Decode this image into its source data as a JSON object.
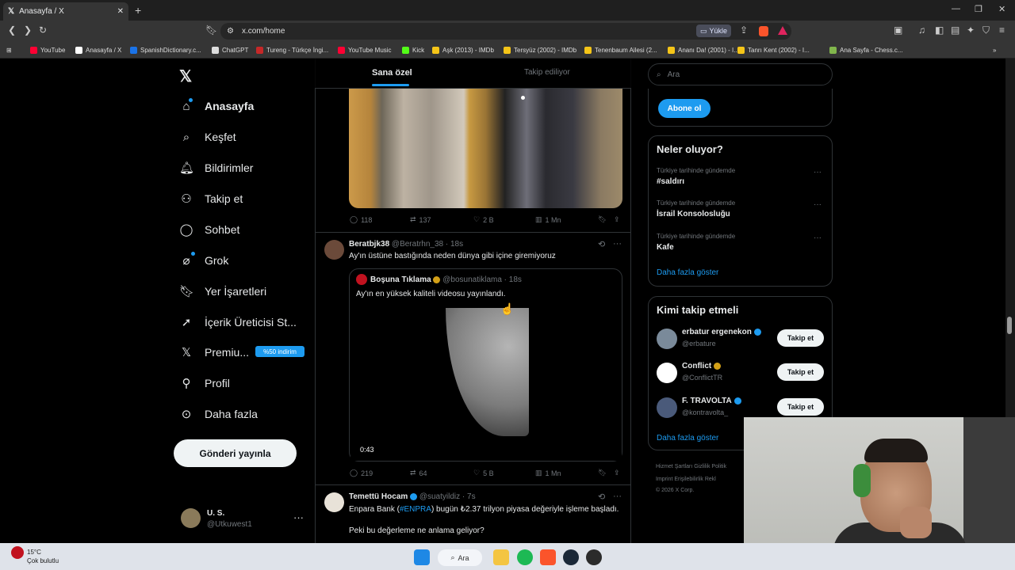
{
  "browser": {
    "tab_title": "Anasayfa / X",
    "url": "x.com/home",
    "yukle_label": "Yükle",
    "bookmarks": [
      {
        "label": "YouTube",
        "color": "#ff0033"
      },
      {
        "label": "Anasayfa / X",
        "color": "#ffffff"
      },
      {
        "label": "SpanishDictionary.c...",
        "color": "#1a73e8"
      },
      {
        "label": "ChatGPT",
        "color": "#dddddd"
      },
      {
        "label": "Tureng - Türkçe İngi...",
        "color": "#c62828"
      },
      {
        "label": "YouTube Music",
        "color": "#ff0033"
      },
      {
        "label": "Kick",
        "color": "#53fc18"
      },
      {
        "label": "Aşk (2013) - IMDb",
        "color": "#f5c518"
      },
      {
        "label": "Tersyüz (2002) - IMDb",
        "color": "#f5c518"
      },
      {
        "label": "Tenenbaum Ailesi (2...",
        "color": "#f5c518"
      },
      {
        "label": "Ananı Da! (2001) - I...",
        "color": "#f5c518"
      },
      {
        "label": "Tanrı Kent (2002) - I...",
        "color": "#f5c518"
      },
      {
        "label": "Ana Sayfa - Chess.c...",
        "color": "#81b64c"
      }
    ]
  },
  "sidebar": {
    "items": [
      {
        "label": "Anasayfa",
        "icon": "home-icon"
      },
      {
        "label": "Keşfet",
        "icon": "search-icon"
      },
      {
        "label": "Bildirimler",
        "icon": "bell-icon"
      },
      {
        "label": "Takip et",
        "icon": "add-user-icon"
      },
      {
        "label": "Sohbet",
        "icon": "chat-icon"
      },
      {
        "label": "Grok",
        "icon": "grok-icon"
      },
      {
        "label": "Yer İşaretleri",
        "icon": "bookmark-icon"
      },
      {
        "label": "İçerik Üreticisi St...",
        "icon": "rocket-icon"
      },
      {
        "label": "Premiu...",
        "icon": "x-icon"
      },
      {
        "label": "Profil",
        "icon": "person-icon"
      },
      {
        "label": "Daha fazla",
        "icon": "more-icon"
      }
    ],
    "premium_badge": "%50 indirim",
    "post_button": "Gönderi yayınla",
    "user": {
      "name": "U. S.",
      "handle": "@Utkuwest1"
    }
  },
  "feed": {
    "tabs": [
      "Sana özel",
      "Takip ediliyor"
    ],
    "post1_actions": {
      "replies": "118",
      "reposts": "137",
      "likes": "2 B",
      "views": "1 Mn"
    },
    "post2": {
      "name": "Beratbjk38",
      "handle": "@Beratrhn_38 · 18s",
      "text": "Ay'ın üstüne bastığında neden dünya gibi içine giremiyoruz",
      "quote_name": "Boşuna Tıklama",
      "quote_handle": "@bosunatiklama · 18s",
      "quote_text": "Ay'ın en yüksek kaliteli videosu yayınlandı.",
      "video_duration": "0:43",
      "replies": "219",
      "reposts": "64",
      "likes": "5 B",
      "views": "1 Mn"
    },
    "post3": {
      "name": "Temettü Hocam",
      "handle": "@suatyildiz · 7s",
      "text_pre": "Enpara Bank (",
      "hashtag": "#ENPRA",
      "text_post": ") bugün ₺2.37 trilyon piyasa değeriyle işleme başladı.",
      "text2": "Peki bu değerleme ne anlama geliyor?"
    }
  },
  "right": {
    "search_placeholder": "Ara",
    "subscribe_label": "Abone ol",
    "trends_title": "Neler oluyor?",
    "trends": [
      {
        "context": "Türkiye tarihinde gündemde",
        "name": "#saldırı"
      },
      {
        "context": "Türkiye tarihinde gündemde",
        "name": "İsrail Konsolosluğu"
      },
      {
        "context": "Türkiye tarihinde gündemde",
        "name": "Kafe"
      }
    ],
    "show_more": "Daha fazla göster",
    "who_title": "Kimi takip etmeli",
    "who": [
      {
        "name": "erbatur ergenekon",
        "handle": "@erbature",
        "button": "Takip et"
      },
      {
        "name": "Conflict",
        "handle": "@ConflictTR",
        "button": "Takip et"
      },
      {
        "name": "F. TRAVOLTA",
        "handle": "@kontravolta_",
        "button": "Takip et"
      }
    ],
    "who_more": "Daha fazla göster",
    "footer1": "Hizmet Şartları    Gizlilik Politik",
    "footer2": "Imprint    Erişilebilirlik    Rekl",
    "footer3": "© 2026 X Corp."
  },
  "taskbar": {
    "temp": "15°C",
    "weather": "Çok bulutlu",
    "search": "Ara"
  }
}
